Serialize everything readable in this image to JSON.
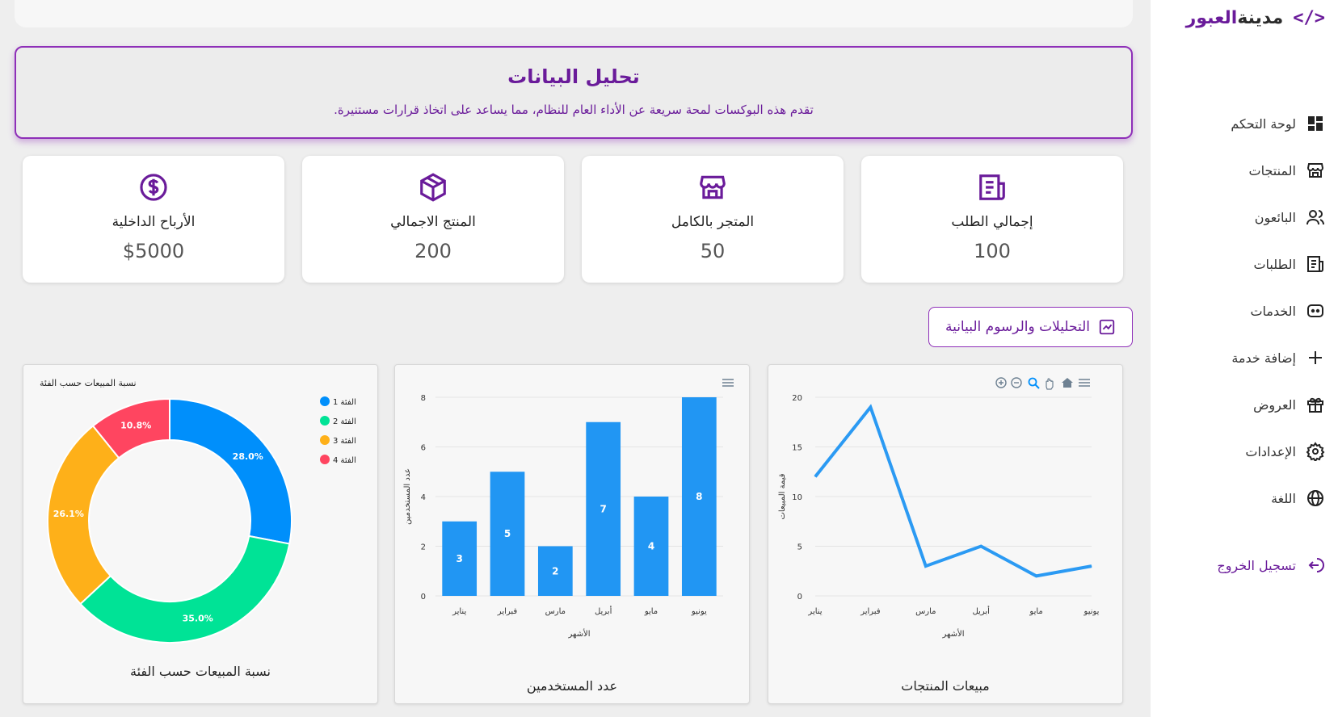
{
  "sidebar": {
    "brand_prefix": "مدينة",
    "brand_accent": "العبور",
    "brand_icon": "code-icon",
    "items": [
      {
        "label": "لوحة التحكم",
        "icon": "dashboard-icon"
      },
      {
        "label": "المنتجات",
        "icon": "store-icon"
      },
      {
        "label": "البائعون",
        "icon": "users-icon"
      },
      {
        "label": "الطلبات",
        "icon": "orders-icon"
      },
      {
        "label": "الخدمات",
        "icon": "services-icon"
      },
      {
        "label": "إضافة خدمة",
        "icon": "plus-icon"
      },
      {
        "label": "العروض",
        "icon": "gift-icon"
      },
      {
        "label": "الإعدادات",
        "icon": "gear-icon"
      },
      {
        "label": "اللغة",
        "icon": "globe-icon"
      }
    ],
    "logout": "تسجيل الخروج"
  },
  "hero": {
    "title": "تحليل البيانات",
    "description": "تقدم هذه البوكسات لمحة سريعة عن الأداء العام للنظام، مما يساعد على اتخاذ قرارات مستنيرة."
  },
  "stats": [
    {
      "title": "إجمالي الطلب",
      "value": "100",
      "icon": "orders-icon"
    },
    {
      "title": "المتجر بالكامل",
      "value": "50",
      "icon": "store-icon"
    },
    {
      "title": "المنتج الاجمالي",
      "value": "200",
      "icon": "box-icon"
    },
    {
      "title": "الأرباح الداخلية",
      "value": "$5000",
      "icon": "dollar-icon"
    }
  ],
  "analytics_button": "التحليلات والرسوم البيانية",
  "colors": {
    "accent": "#6a1b9a",
    "bar": "#2196f3",
    "line": "#2b9af3",
    "pie": [
      "#008ffb",
      "#00e396",
      "#feb019",
      "#ff4560"
    ]
  },
  "chart_data": [
    {
      "type": "line",
      "caption": "مبيعات المنتجات",
      "categories": [
        "يناير",
        "فبراير",
        "مارس",
        "أبريل",
        "مايو",
        "يونيو"
      ],
      "values": [
        12,
        19,
        3,
        5,
        2,
        3
      ],
      "xlabel": "الأشهر",
      "ylabel": "قيمة المبيعات",
      "ylim": [
        0,
        20
      ],
      "yticks": [
        "0",
        "5",
        "10",
        "15",
        "20"
      ],
      "toolbar": [
        "zoom-in-icon",
        "zoom-out-icon",
        "search-icon",
        "pan-icon",
        "home-icon",
        "menu-icon"
      ]
    },
    {
      "type": "bar",
      "caption": "عدد المستخدمين",
      "categories": [
        "يناير",
        "فبراير",
        "مارس",
        "أبريل",
        "مايو",
        "يونيو"
      ],
      "values": [
        3,
        5,
        2,
        7,
        4,
        8
      ],
      "xlabel": "الأشهر",
      "ylabel": "عدد المستخدمين",
      "ylim": [
        0,
        8
      ],
      "yticks": [
        "0",
        "2",
        "4",
        "6",
        "8"
      ]
    },
    {
      "type": "pie",
      "caption": "نسبة المبيعات حسب الفئة",
      "title": "نسبة المبيعات حسب الفئة",
      "categories": [
        "الفئة 1",
        "الفئة 2",
        "الفئة 3",
        "الفئة 4"
      ],
      "values": [
        28.0,
        35.0,
        26.1,
        10.8
      ],
      "labels": [
        "28.0%",
        "35.0%",
        "26.1%",
        "10.8%"
      ],
      "legend": "top-right"
    }
  ]
}
